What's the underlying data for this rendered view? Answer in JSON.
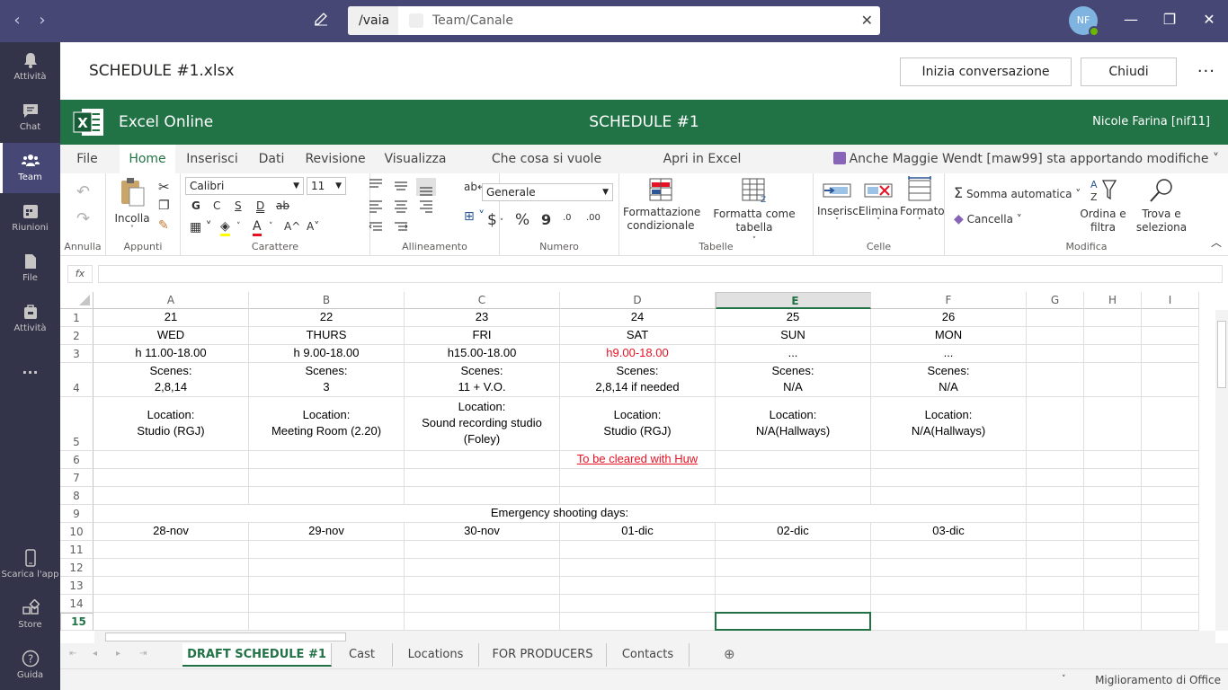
{
  "titlebar": {
    "search_prefix": "/vaia",
    "search_text": "Team/Canale",
    "avatar_initials": "NF"
  },
  "rail": {
    "items": [
      {
        "label": "Attività",
        "icon": "bell-icon"
      },
      {
        "label": "Chat",
        "icon": "chat-icon"
      },
      {
        "label": "Team",
        "icon": "team-icon"
      },
      {
        "label": "Riunioni",
        "icon": "calendar-icon"
      },
      {
        "label": "File",
        "icon": "file-icon"
      },
      {
        "label": "Attività",
        "icon": "briefcase-icon"
      },
      {
        "label": "...",
        "icon": "more-icon"
      },
      {
        "label": "Scarica l'app",
        "icon": "phone-icon"
      },
      {
        "label": "Store",
        "icon": "store-icon"
      },
      {
        "label": "Guida",
        "icon": "help-icon"
      }
    ]
  },
  "header": {
    "file_title": "SCHEDULE #1.xlsx",
    "start_conversation": "Inizia conversazione",
    "close": "Chiudi"
  },
  "excel": {
    "app_name": "Excel Online",
    "doc_title": "SCHEDULE #1",
    "user": "Nicole Farina [nif11]"
  },
  "ribbon_tabs": [
    "File",
    "Home",
    "Inserisci",
    "Dati",
    "Revisione",
    "Visualizza",
    "Che cosa si vuole fare?",
    "Apri in Excel"
  ],
  "coauthor": "Anche Maggie Wendt [maw99] sta apportando modifiche",
  "ribbon": {
    "groups": {
      "annulla": "Annulla",
      "appunti": "Appunti",
      "carattere": "Carattere",
      "allineamento": "Allineamento",
      "numero": "Numero",
      "tabelle": "Tabelle",
      "celle": "Celle",
      "modifica": "Modifica"
    },
    "incolla": "Incolla",
    "font_name": "Calibri",
    "font_size": "11",
    "bold": "G",
    "italic": "C",
    "underline": "S",
    "double_underline": "D",
    "strike": "ab",
    "grow": "A^",
    "shrink": "A˅",
    "number_format": "Generale",
    "currency": "$",
    "percent": "%",
    "comma": "9",
    "inc_decimal": ".0",
    "dec_decimal": ".00",
    "cond_format": "Formattazione condizionale",
    "format_table": "Formatta come tabella",
    "insert": "Inserisci",
    "delete": "Elimina",
    "format": "Formato",
    "autosum": "Somma automatica",
    "clear": "Cancella",
    "sort_filter": "Ordina e filtra",
    "find_select": "Trova e seleziona"
  },
  "formula_bar": {
    "fx": "fx",
    "value": ""
  },
  "grid": {
    "columns": [
      "A",
      "B",
      "C",
      "D",
      "E",
      "F",
      "G",
      "H",
      "I"
    ],
    "selected_column": "E",
    "rows": [
      "1",
      "2",
      "3",
      "4",
      "5",
      "6",
      "7",
      "8",
      "9",
      "10",
      "11",
      "12",
      "13",
      "14",
      "15"
    ],
    "selected_row": "15",
    "data": {
      "r1": [
        "21",
        "22",
        "23",
        "24",
        "25",
        "26"
      ],
      "r2": [
        "WED",
        "THURS",
        "FRI",
        "SAT",
        "SUN",
        "MON"
      ],
      "r3": [
        "h 11.00-18.00",
        "h 9.00-18.00",
        "h15.00-18.00",
        "h9.00-18.00",
        "...",
        "..."
      ],
      "r4": [
        "Scenes:\n2,8,14",
        "Scenes:\n3",
        "Scenes:\n11 + V.O.",
        "Scenes:\n2,8,14 if needed",
        "Scenes:\nN/A",
        "Scenes:\nN/A"
      ],
      "r5": [
        "Location:\nStudio (RGJ)",
        "Location:\nMeeting Room (2.20)",
        "Location:\nSound recording studio\n(Foley)",
        "Location:\nStudio (RGJ)",
        "Location:\nN/A(Hallways)",
        "Location:\nN/A(Hallways)"
      ],
      "r6_d": "To be cleared with Huw",
      "r9": "Emergency shooting days:",
      "r10": [
        "28-nov",
        "29-nov",
        "30-nov",
        "01-dic",
        "02-dic",
        "03-dic"
      ]
    }
  },
  "sheets": [
    "DRAFT SCHEDULE #1",
    "Cast",
    "Locations",
    "FOR PRODUCERS",
    "Contacts"
  ],
  "status": "Miglioramento di Office",
  "colors": {
    "teams_purple": "#464775",
    "rail": "#33344a",
    "excel_green": "#217346",
    "red_text": "#e81123"
  }
}
